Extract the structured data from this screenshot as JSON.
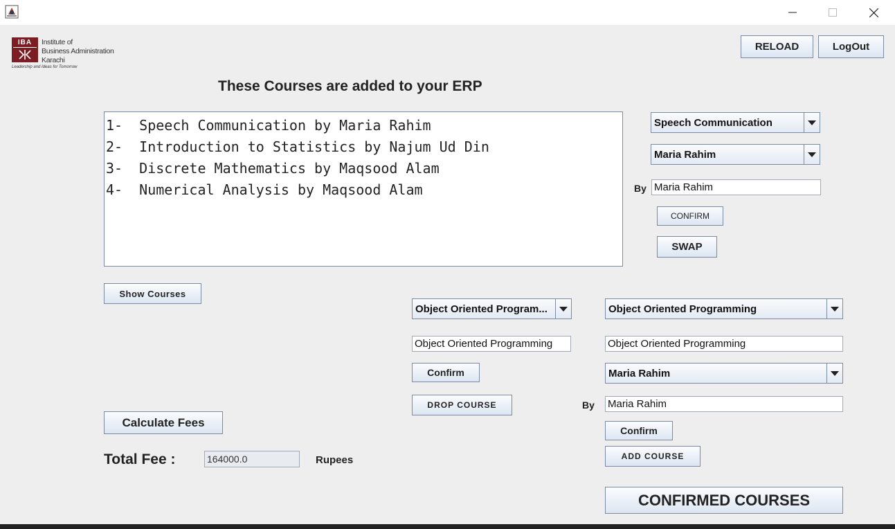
{
  "window": {
    "minimize_icon": "minimize-icon",
    "maximize_icon": "maximize-icon",
    "close_icon": "close-icon"
  },
  "logo": {
    "mark": "IBA",
    "lines": [
      "Institute of",
      "Business Administration",
      "Karachi"
    ],
    "tagline": "Leadership and Ideas for Tomorrow",
    "color": "#7b1d22"
  },
  "header": {
    "reload_label": "RELOAD",
    "logout_label": "LogOut",
    "title": "These Courses are added to your ERP"
  },
  "courses_list": [
    "1-  Speech Communication by Maria Rahim",
    "2-  Introduction to Statistics by Najum Ud Din",
    "3-  Discrete Mathematics by Maqsood Alam",
    "4-  Numerical Analysis by Maqsood Alam"
  ],
  "swap_panel": {
    "course_select": "Speech Communication",
    "teacher_select": "Maria Rahim",
    "by_label": "By",
    "by_value": "Maria Rahim",
    "confirm_label": "CONFIRM",
    "swap_label": "SWAP"
  },
  "show_courses_label": "Show Courses",
  "drop_panel": {
    "course_select": "Object Oriented Program...",
    "course_field": "Object Oriented Programming",
    "confirm_label": "Confirm",
    "drop_label": "DROP COURSE"
  },
  "add_panel": {
    "course_select": "Object Oriented Programming",
    "course_field": "Object Oriented Programming",
    "teacher_select": "Maria Rahim",
    "by_label": "By",
    "by_value": "Maria Rahim",
    "confirm_label": "Confirm",
    "add_label": "ADD COURSE"
  },
  "fees": {
    "calculate_label": "Calculate Fees",
    "total_label": "Total Fee :",
    "total_value": "164000.0",
    "unit": "Rupees"
  },
  "confirmed_courses_label": "CONFIRMED COURSES"
}
